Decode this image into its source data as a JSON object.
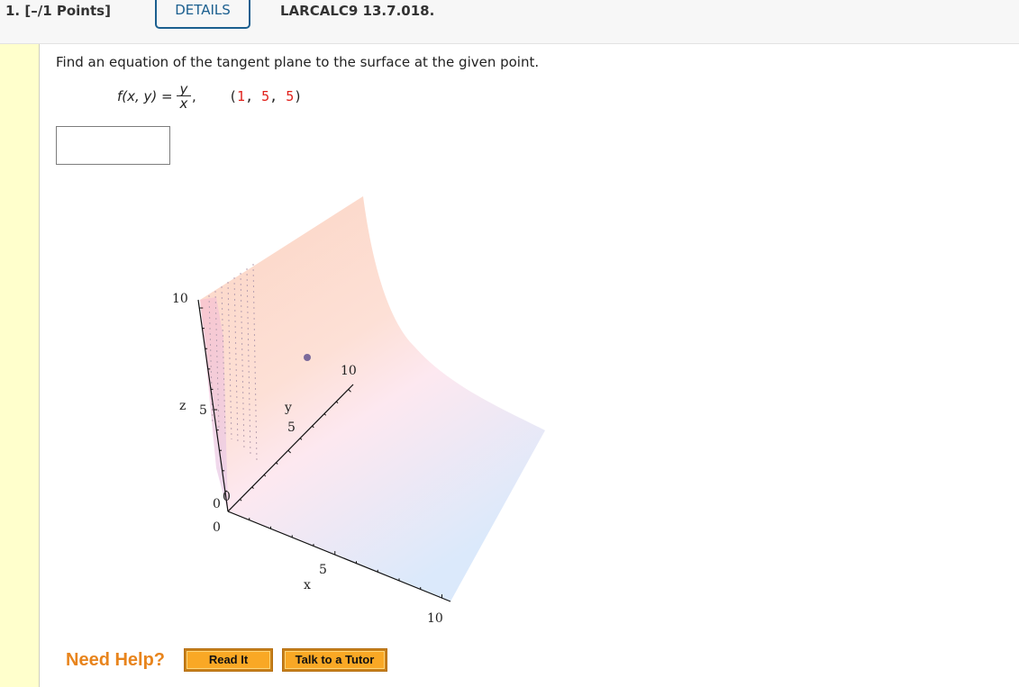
{
  "header": {
    "question_label": "1.  [–/1 Points]",
    "details_label": "DETAILS",
    "problem_code": "LARCALC9 13.7.018."
  },
  "question": {
    "prompt": "Find an equation of the tangent plane to the surface at the given point.",
    "function_lhs": "f(x, y) = ",
    "numerator": "y",
    "denominator": "x",
    "trailing_comma": ",",
    "point": {
      "open": "(",
      "x": "1",
      "sep1": ", ",
      "y": "5",
      "sep2": ", ",
      "z": "5",
      "close": ")"
    },
    "answer_value": ""
  },
  "plot": {
    "description": "3D surface plot of z = y/x with marked point",
    "colors": {
      "top": "#fcd5c4",
      "mid": "#fde8f0",
      "bottom": "#dbe9fb",
      "point": "#7b6a9b"
    },
    "axes": {
      "x": {
        "label": "x",
        "ticks": [
          "0",
          "5",
          "10"
        ]
      },
      "y": {
        "label": "y",
        "ticks": [
          "0",
          "5",
          "10"
        ]
      },
      "z": {
        "label": "z",
        "ticks": [
          "0",
          "5",
          "10"
        ]
      }
    },
    "marked_point": [
      1,
      5,
      5
    ]
  },
  "help": {
    "label": "Need Help?",
    "buttons": [
      "Read It",
      "Talk to a Tutor"
    ]
  }
}
